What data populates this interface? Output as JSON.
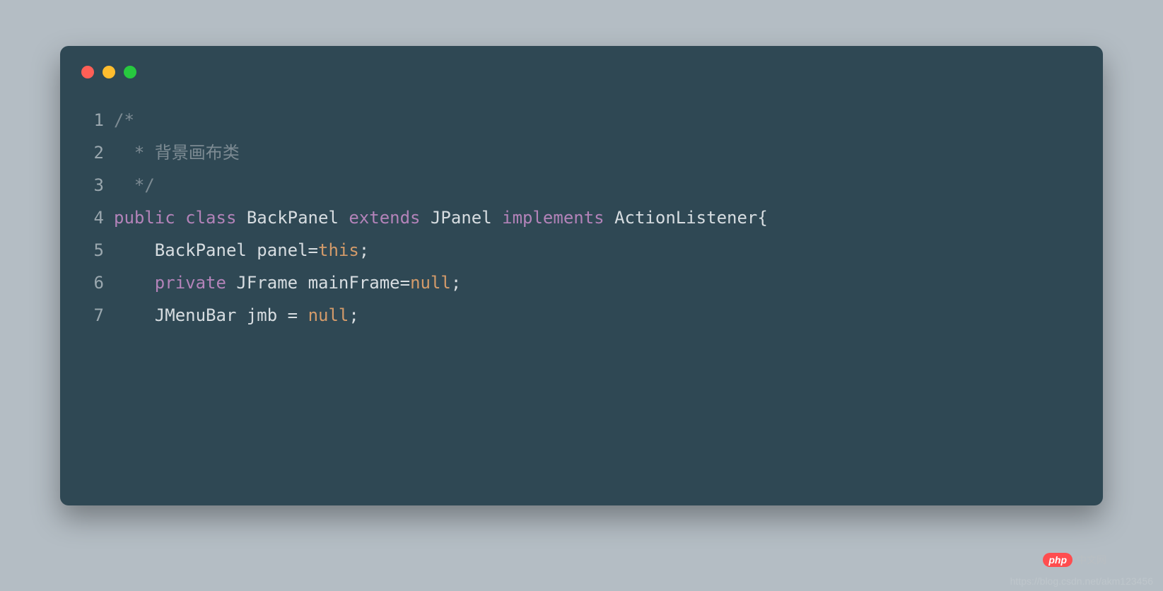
{
  "watermark": {
    "badge": "php",
    "text": "中文网",
    "url": "https://blog.csdn.net/akm123456"
  },
  "lines": [
    {
      "num": "1",
      "tokens": [
        {
          "cls": "tok-comment",
          "text": "/*"
        }
      ]
    },
    {
      "num": "2",
      "tokens": [
        {
          "cls": "tok-comment",
          "text": "  * 背景画布类"
        }
      ]
    },
    {
      "num": "3",
      "tokens": [
        {
          "cls": "tok-comment",
          "text": "  */"
        }
      ]
    },
    {
      "num": "4",
      "tokens": [
        {
          "cls": "tok-keyword",
          "text": "public"
        },
        {
          "cls": "tok-punct",
          "text": " "
        },
        {
          "cls": "tok-keyword",
          "text": "class"
        },
        {
          "cls": "tok-punct",
          "text": " "
        },
        {
          "cls": "tok-type",
          "text": "BackPanel"
        },
        {
          "cls": "tok-punct",
          "text": " "
        },
        {
          "cls": "tok-keyword",
          "text": "extends"
        },
        {
          "cls": "tok-punct",
          "text": " "
        },
        {
          "cls": "tok-type",
          "text": "JPanel"
        },
        {
          "cls": "tok-punct",
          "text": " "
        },
        {
          "cls": "tok-keyword",
          "text": "implements"
        },
        {
          "cls": "tok-punct",
          "text": " "
        },
        {
          "cls": "tok-type",
          "text": "ActionListener"
        },
        {
          "cls": "tok-punct",
          "text": "{"
        }
      ]
    },
    {
      "num": "5",
      "tokens": [
        {
          "cls": "tok-punct",
          "text": "    "
        },
        {
          "cls": "tok-type",
          "text": "BackPanel"
        },
        {
          "cls": "tok-punct",
          "text": " "
        },
        {
          "cls": "tok-ident",
          "text": "panel"
        },
        {
          "cls": "tok-punct",
          "text": "="
        },
        {
          "cls": "tok-this",
          "text": "this"
        },
        {
          "cls": "tok-punct",
          "text": ";"
        }
      ]
    },
    {
      "num": "6",
      "tokens": [
        {
          "cls": "tok-punct",
          "text": "    "
        },
        {
          "cls": "tok-keyword",
          "text": "private"
        },
        {
          "cls": "tok-punct",
          "text": " "
        },
        {
          "cls": "tok-type",
          "text": "JFrame"
        },
        {
          "cls": "tok-punct",
          "text": " "
        },
        {
          "cls": "tok-ident",
          "text": "mainFrame"
        },
        {
          "cls": "tok-punct",
          "text": "="
        },
        {
          "cls": "tok-null",
          "text": "null"
        },
        {
          "cls": "tok-punct",
          "text": ";"
        }
      ]
    },
    {
      "num": "7",
      "tokens": [
        {
          "cls": "tok-punct",
          "text": "    "
        },
        {
          "cls": "tok-type",
          "text": "JMenuBar"
        },
        {
          "cls": "tok-punct",
          "text": " "
        },
        {
          "cls": "tok-ident",
          "text": "jmb"
        },
        {
          "cls": "tok-punct",
          "text": " = "
        },
        {
          "cls": "tok-null",
          "text": "null"
        },
        {
          "cls": "tok-punct",
          "text": ";"
        }
      ]
    }
  ]
}
